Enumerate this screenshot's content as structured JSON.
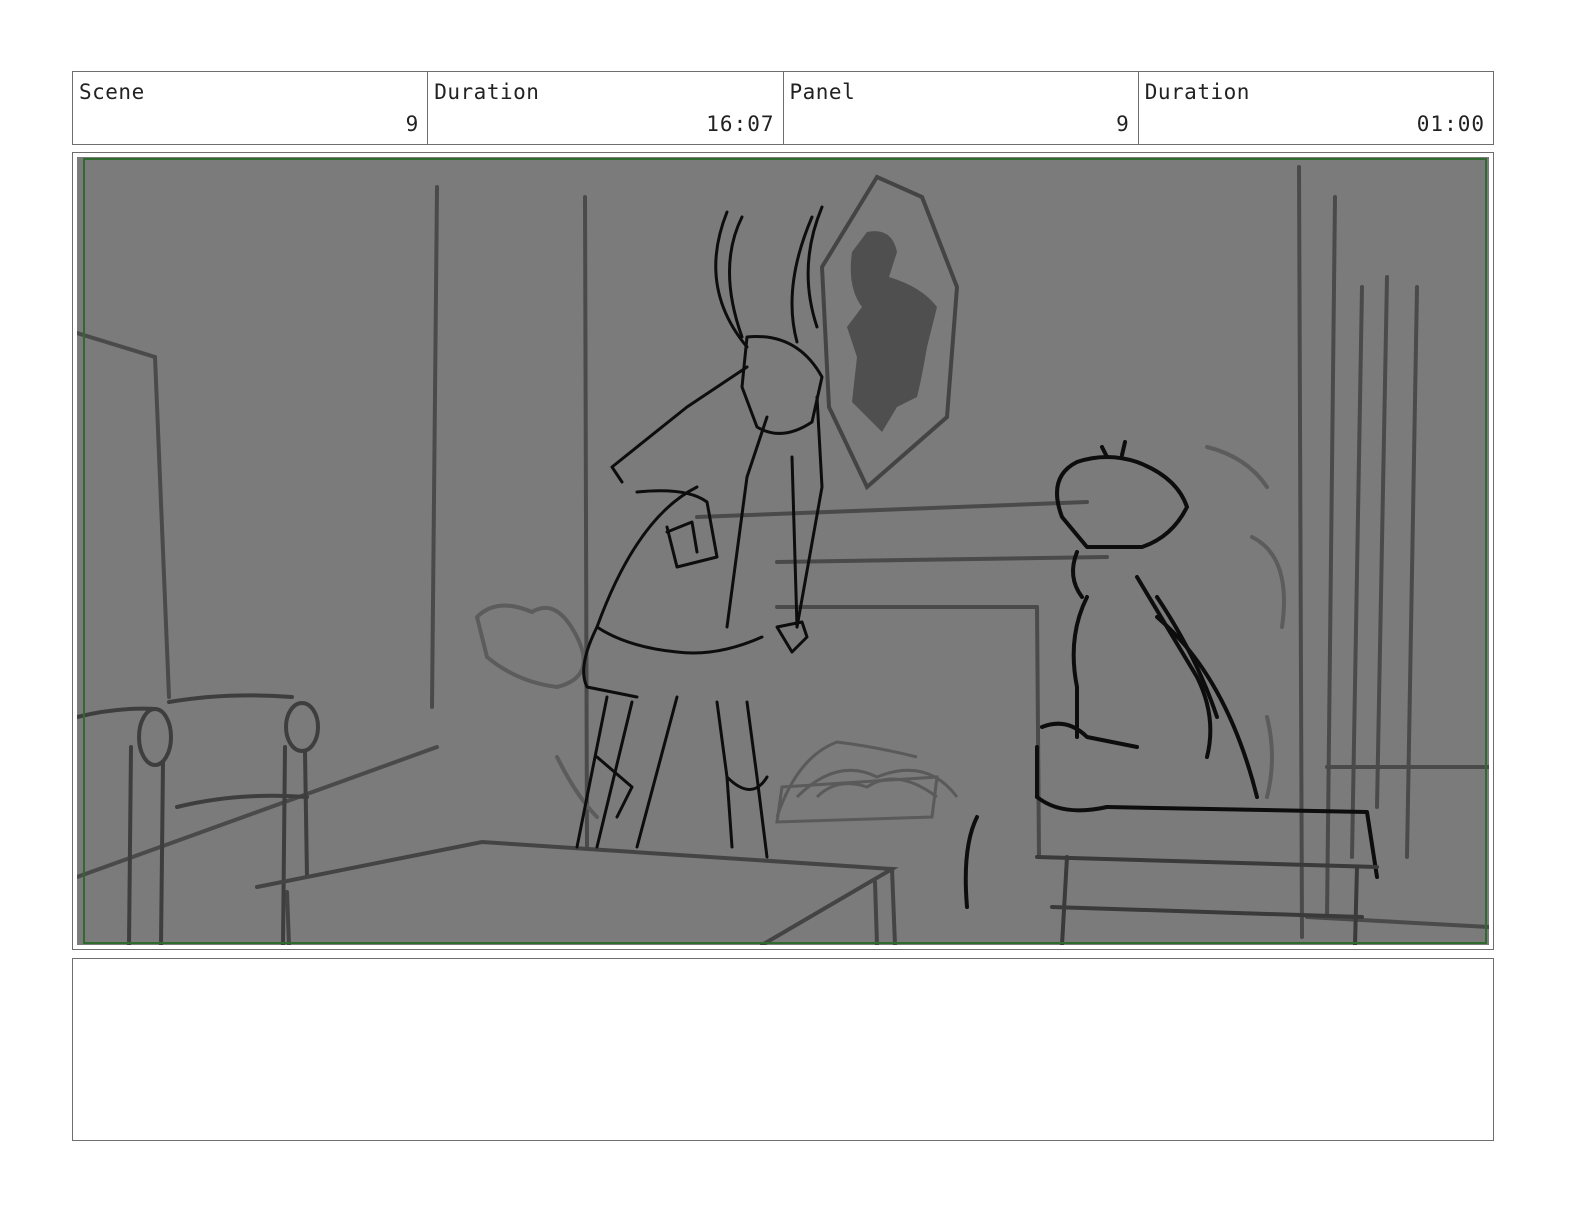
{
  "header": {
    "scene": {
      "label": "Scene",
      "value": "9"
    },
    "scene_duration": {
      "label": "Duration",
      "value": "16:07"
    },
    "panel": {
      "label": "Panel",
      "value": "9"
    },
    "panel_duration": {
      "label": "Duration",
      "value": "01:00"
    }
  },
  "colors": {
    "sketch_background": "#7b7b7b",
    "safe_frame": "#2f6b2f",
    "border": "#6e6e6e"
  },
  "notes": {
    "text": ""
  }
}
